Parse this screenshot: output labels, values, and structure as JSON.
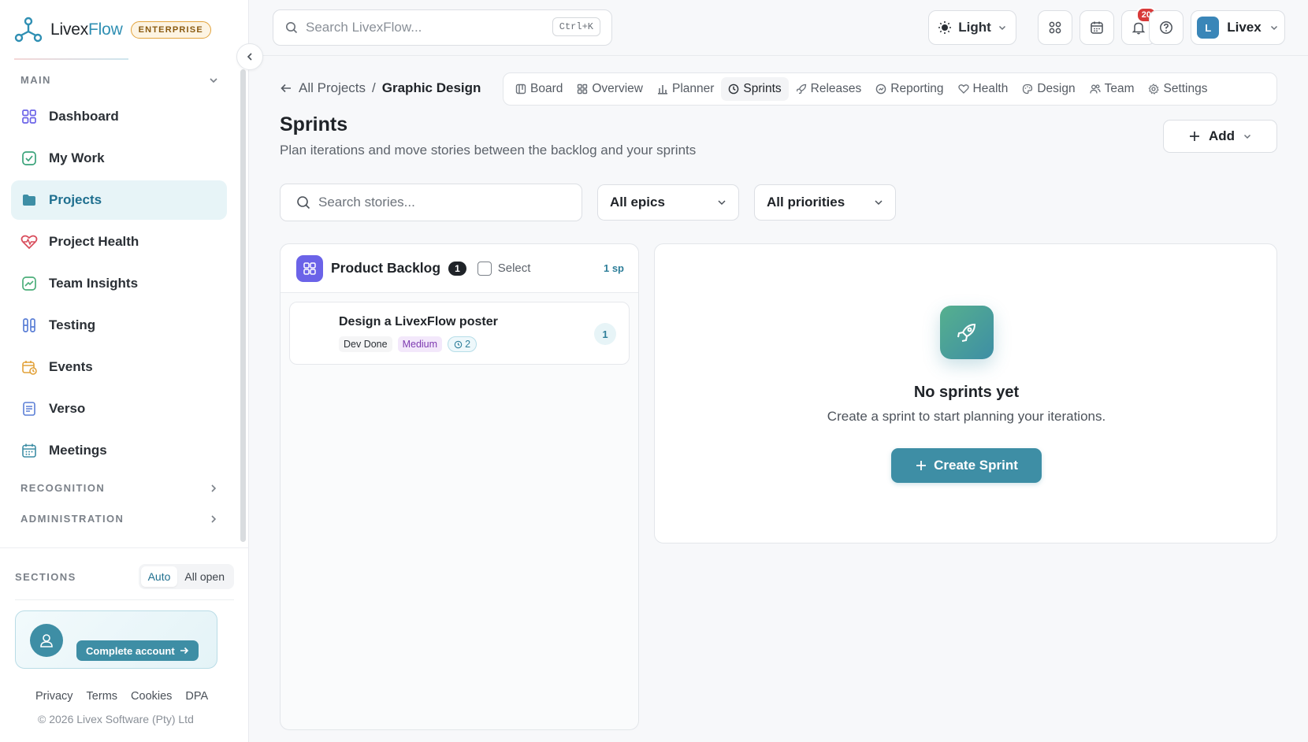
{
  "brand": {
    "name_part1": "Livex",
    "name_part2": "Flow",
    "edition_badge": "ENTERPRISE"
  },
  "sidebar": {
    "main_section": "MAIN",
    "items": [
      {
        "label": "Dashboard",
        "icon": "grid-icon"
      },
      {
        "label": "My Work",
        "icon": "check-square-icon"
      },
      {
        "label": "Projects",
        "icon": "folder-icon",
        "active": true
      },
      {
        "label": "Project Health",
        "icon": "heart-pulse-icon"
      },
      {
        "label": "Team Insights",
        "icon": "chart-up-icon"
      },
      {
        "label": "Testing",
        "icon": "test-tubes-icon"
      },
      {
        "label": "Events",
        "icon": "calendar-clock-icon"
      },
      {
        "label": "Verso",
        "icon": "document-icon"
      },
      {
        "label": "Meetings",
        "icon": "calendar-icon"
      }
    ],
    "recognition_section": "RECOGNITION",
    "administration_section": "ADMINISTRATION",
    "sections_label": "SECTIONS",
    "sections_options": [
      "Auto",
      "All open"
    ],
    "sections_selected": "Auto",
    "account_cta": "Complete account",
    "footer_links": [
      "Privacy",
      "Terms",
      "Cookies",
      "DPA"
    ],
    "copyright": "© 2026 Livex Software (Pty) Ltd"
  },
  "topbar": {
    "search_placeholder": "Search LivexFlow...",
    "search_shortcut": "Ctrl+K",
    "theme_label": "Light",
    "notifications_count": "20",
    "user_initial": "L",
    "user_name": "Livex"
  },
  "breadcrumb": {
    "parent": "All Projects",
    "separator": "/",
    "current": "Graphic Design"
  },
  "tabs": [
    {
      "label": "Board",
      "icon": "board-icon"
    },
    {
      "label": "Overview",
      "icon": "grid-icon"
    },
    {
      "label": "Planner",
      "icon": "bar-chart-icon"
    },
    {
      "label": "Sprints",
      "icon": "clock-icon",
      "active": true
    },
    {
      "label": "Releases",
      "icon": "rocket-icon"
    },
    {
      "label": "Reporting",
      "icon": "report-icon"
    },
    {
      "label": "Health",
      "icon": "heart-pulse-icon"
    },
    {
      "label": "Design",
      "icon": "palette-icon"
    },
    {
      "label": "Team",
      "icon": "users-icon"
    },
    {
      "label": "Settings",
      "icon": "gear-icon"
    }
  ],
  "page": {
    "title": "Sprints",
    "subtitle": "Plan iterations and move stories between the backlog and your sprints",
    "add_label": "Add"
  },
  "filters": {
    "search_placeholder": "Search stories...",
    "epic_selected": "All epics",
    "priority_selected": "All priorities"
  },
  "backlog": {
    "title": "Product Backlog",
    "count": "1",
    "select_label": "Select",
    "story_points_total": "1 sp",
    "stories": [
      {
        "title": "Design a LivexFlow poster",
        "status": "Dev Done",
        "priority": "Medium",
        "subtasks": "2",
        "points": "1"
      }
    ]
  },
  "sprints": {
    "empty_title": "No sprints yet",
    "empty_description": "Create a sprint to start planning your iterations.",
    "create_label": "Create Sprint"
  },
  "colors": {
    "accent": "#3e8ea5",
    "active_bg": "#e7f4f7",
    "backlog_icon": "#6b63e8",
    "notif_badge": "#d83a3a",
    "enterprise_border": "#e2a23a"
  }
}
